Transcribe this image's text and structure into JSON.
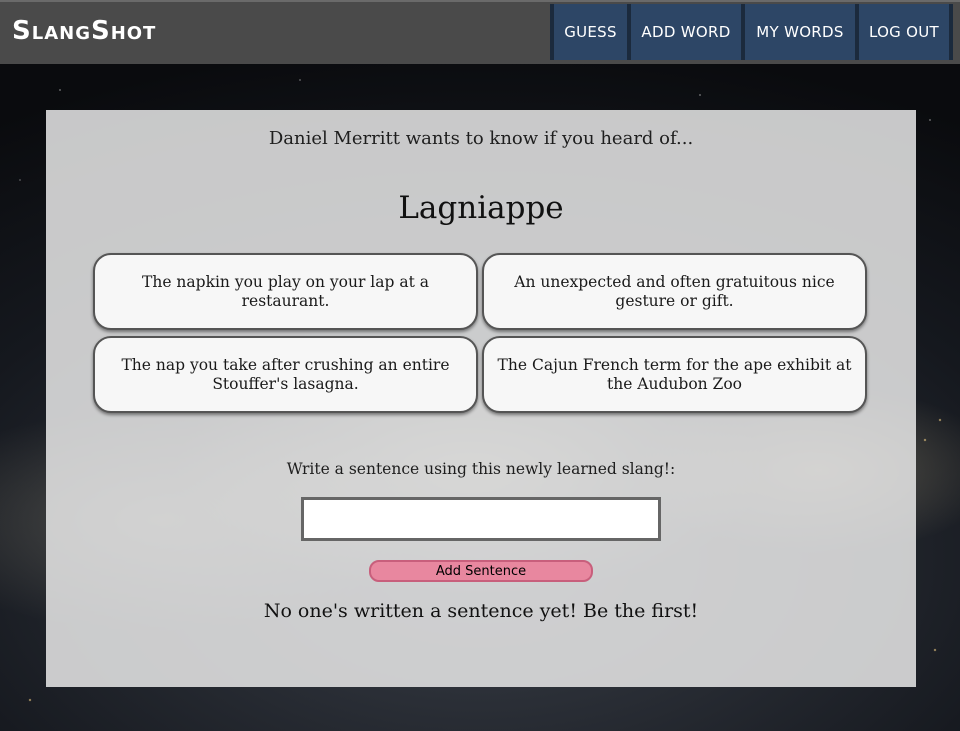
{
  "app": {
    "brand": "SlangShot"
  },
  "nav": {
    "guess": "GUESS",
    "add_word": "ADD WORD",
    "my_words": "MY WORDS",
    "log_out": "LOG OUT"
  },
  "quiz": {
    "prompt": "Daniel Merritt wants to know if you heard of...",
    "word": "Lagniappe",
    "choices": [
      "The napkin you play on your lap at a restaurant.",
      "An unexpected and often gratuitous nice gesture or gift.",
      "The nap you take after crushing an entire Stouffer's lasagna.",
      "The Cajun French term for the ape exhibit at the Audubon Zoo"
    ]
  },
  "sentence": {
    "label": "Write a sentence using this newly learned slang!:",
    "input_value": "",
    "input_placeholder": "",
    "add_button": "Add Sentence",
    "empty_message": "No one's written a sentence yet! Be the first!"
  },
  "colors": {
    "nav_background": "#4a4a4a",
    "nav_button": "#2d4666",
    "panel_background": "#e8e8e8",
    "add_button": "#e8879f"
  },
  "icons": {}
}
